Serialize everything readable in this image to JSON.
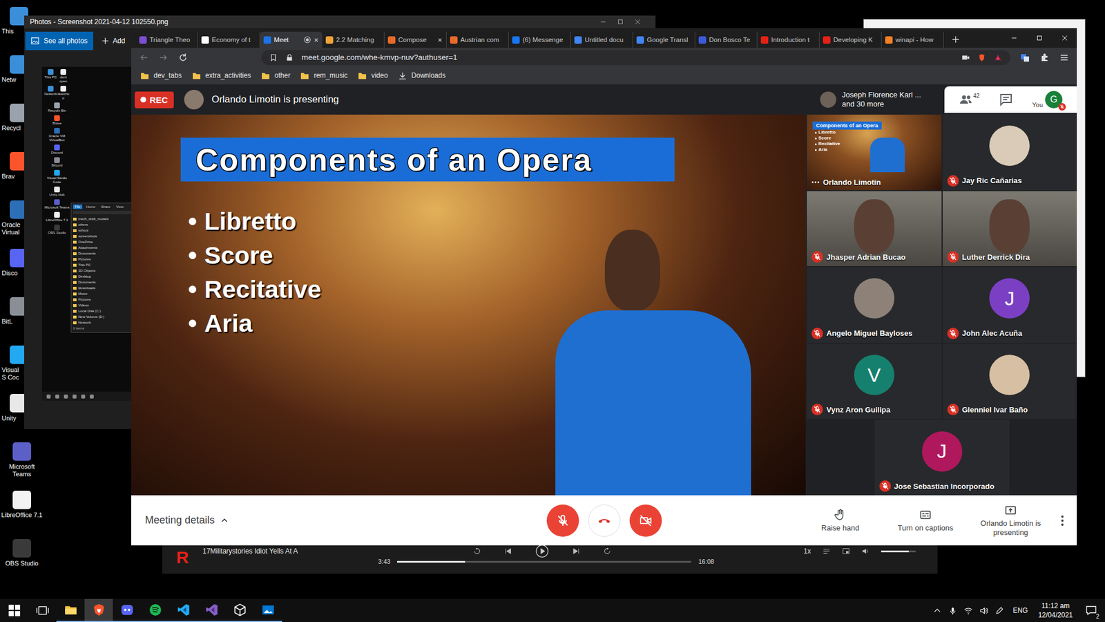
{
  "desktop": {
    "icons_cut": [
      {
        "label": "This"
      },
      {
        "label": "Netw"
      },
      {
        "label": "Recycl"
      },
      {
        "label": "Brav"
      },
      {
        "label": "Oracle Virtual"
      },
      {
        "label": "Disco"
      },
      {
        "label": "BitL"
      },
      {
        "label": "Visual S Coc"
      },
      {
        "label": "Unity"
      }
    ],
    "icons": [
      {
        "label": "Microsoft Teams"
      },
      {
        "label": "LibreOffice 7.1"
      },
      {
        "label": "OBS Studio"
      }
    ]
  },
  "photos_window": {
    "title": "Photos - Screenshot 2021-04-12 102550.png",
    "see_all": "See all photos",
    "add": "Add",
    "thumbnail": {
      "icons": [
        "This PC",
        "dont open",
        "Network",
        "sketchup",
        "Recycle Bin",
        "Brave",
        "Oracle VM VirtualBox",
        "Discord",
        "BitLord",
        "Visual Studio Code",
        "Unity Hub",
        "Microsoft Teams",
        "LibreOffice 7.1",
        "OBS Studio"
      ],
      "ribbon": [
        {
          "label": "File",
          "selected": true
        },
        {
          "label": "Home",
          "selected": false
        },
        {
          "label": "Share",
          "selected": false
        },
        {
          "label": "View",
          "selected": false
        }
      ],
      "explorer_items": [
        "mech_draft_models",
        "others",
        "school",
        "screenshots",
        "OneDrive",
        "Attachments",
        "Documents",
        "Pictures",
        "This PC",
        "3D Objects",
        "Desktop",
        "Documents",
        "Downloads",
        "Music",
        "Pictures",
        "Videos",
        "Local Disk (C:)",
        "New Volume (D:)",
        "Network"
      ],
      "status": "0 items"
    }
  },
  "browser": {
    "tabs": [
      {
        "label": "Triangle Theo",
        "selected": false,
        "closable": false,
        "recording": false
      },
      {
        "label": "Economy of t",
        "selected": false,
        "closable": false,
        "recording": false
      },
      {
        "label": "Meet",
        "selected": true,
        "closable": true,
        "recording": true
      },
      {
        "label": "2.2 Matching",
        "selected": false,
        "closable": false,
        "recording": false
      },
      {
        "label": "Compose",
        "selected": false,
        "closable": true,
        "recording": false
      },
      {
        "label": "Austrian com",
        "selected": false,
        "closable": false,
        "recording": false
      },
      {
        "label": "(6) Messenge",
        "selected": false,
        "closable": false,
        "recording": false
      },
      {
        "label": "Untitled docu",
        "selected": false,
        "closable": false,
        "recording": false
      },
      {
        "label": "Google Transl",
        "selected": false,
        "closable": false,
        "recording": false
      },
      {
        "label": "Don Bosco Te",
        "selected": false,
        "closable": false,
        "recording": false
      },
      {
        "label": "Introduction t",
        "selected": false,
        "closable": false,
        "recording": false
      },
      {
        "label": "Developing K",
        "selected": false,
        "closable": false,
        "recording": false
      },
      {
        "label": "winapi - How",
        "selected": false,
        "closable": false,
        "recording": false
      }
    ],
    "url": "meet.google.com/whe-kmvp-nuv?authuser=1",
    "bookmarks": [
      {
        "label": "dev_tabs",
        "kind": "folder"
      },
      {
        "label": "extra_activities",
        "kind": "folder"
      },
      {
        "label": "other",
        "kind": "folder"
      },
      {
        "label": "rem_music",
        "kind": "folder"
      },
      {
        "label": "video",
        "kind": "folder"
      },
      {
        "label": "Downloads",
        "kind": "download"
      }
    ]
  },
  "meet": {
    "rec": "REC",
    "presenting": "Orlando Limotin is presenting",
    "others_line1": "Joseph Florence Karl ...",
    "others_line2": "and 30 more",
    "people_count": "42",
    "you_label": "You",
    "you_initial": "G",
    "you_muted": true,
    "slide": {
      "title": "Components of an Opera",
      "bullets": [
        "Libretto",
        "Score",
        "Recitative",
        "Aria"
      ]
    },
    "tiles": [
      {
        "name": "Orlando Limotin",
        "kind": "presenting",
        "muted": false
      },
      {
        "name": "Jay Ric Cañarias",
        "kind": "photo",
        "muted": true
      },
      {
        "name": "Jhasper Adrian Bucao",
        "kind": "video",
        "muted": true
      },
      {
        "name": "Luther Derrick Dira",
        "kind": "video",
        "muted": true
      },
      {
        "name": "Angelo Miguel Bayloses",
        "kind": "photo",
        "muted": true
      },
      {
        "name": "John Alec Acuña",
        "kind": "letter",
        "initial": "J",
        "color": "#7b3fc4",
        "muted": true
      },
      {
        "name": "Vynz Aron Guilipa",
        "kind": "letter",
        "initial": "V",
        "color": "#16806e",
        "muted": true
      },
      {
        "name": "Glenniel Ivar Baño",
        "kind": "photo",
        "muted": true
      },
      {
        "name": "Jose Sebastian Incorporado",
        "kind": "letter",
        "initial": "J",
        "color": "#b0185e",
        "muted": true
      }
    ],
    "meeting_details": "Meeting details",
    "controls": {
      "mic_on": false,
      "camera_on": false
    },
    "actions": [
      {
        "label": "Raise hand",
        "kind": "hand"
      },
      {
        "label": "Turn on captions",
        "kind": "captions"
      },
      {
        "label": "Orlando Limotin is presenting",
        "kind": "present"
      }
    ]
  },
  "media_player": {
    "logo": "R",
    "title": "17Militarystories Idiot Yells At A",
    "elapsed": "3:43",
    "total": "16:08",
    "level": 0.23,
    "speed": "1x",
    "volume": 0.8
  },
  "taskbar": {
    "apps": [
      {
        "kind": "explorer",
        "open": true,
        "active": false
      },
      {
        "kind": "brave",
        "open": true,
        "active": true
      },
      {
        "kind": "discord",
        "open": true,
        "active": false
      },
      {
        "kind": "spotify",
        "open": true,
        "active": false
      },
      {
        "kind": "vscode",
        "open": true,
        "active": false
      },
      {
        "kind": "visualstudio",
        "open": true,
        "active": false
      },
      {
        "kind": "unity",
        "open": true,
        "active": false
      },
      {
        "kind": "photos",
        "open": true,
        "active": false
      }
    ],
    "tray": {
      "language": "ENG",
      "time": "11:12 am",
      "date": "12/04/2021",
      "notifications": "2"
    }
  }
}
